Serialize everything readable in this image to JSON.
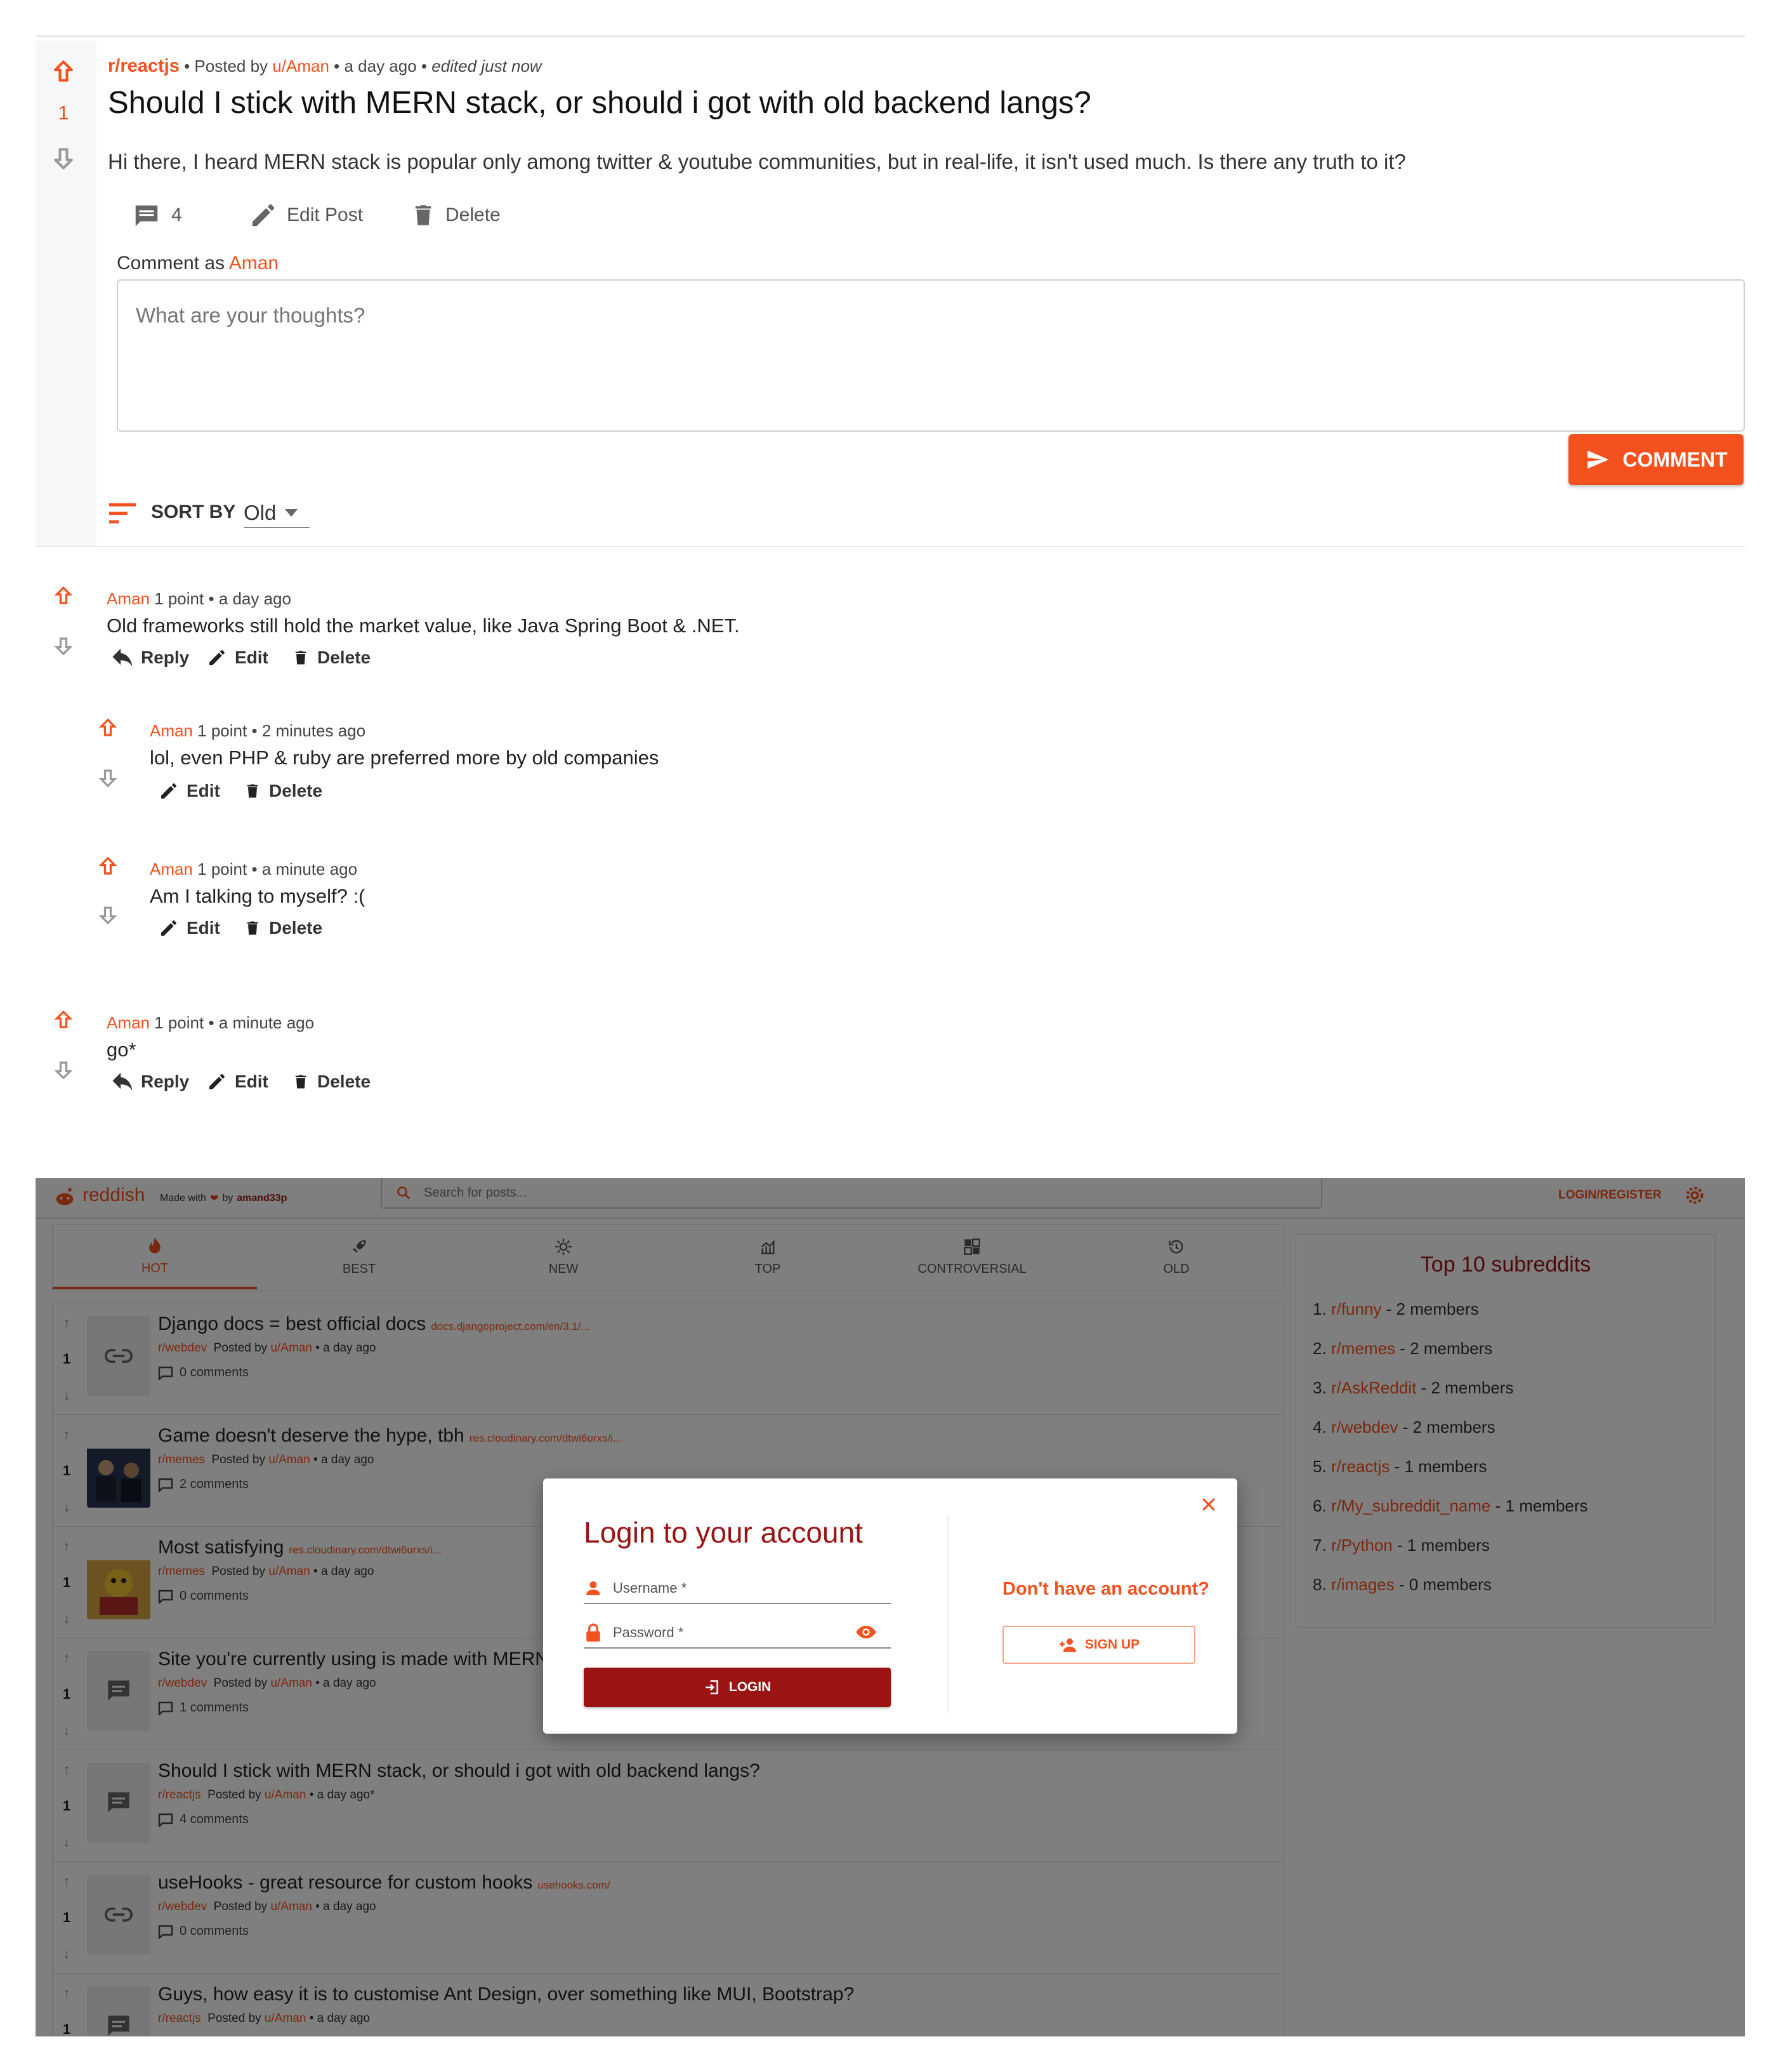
{
  "post": {
    "subreddit": "r/reactjs",
    "posted_by_prefix": "• Posted by",
    "author": "u/Aman",
    "time": "• a day ago •",
    "edited": "edited just now",
    "score": "1",
    "title": "Should I stick with MERN stack, or should i got with old backend langs?",
    "body": "Hi there, I heard MERN stack is popular only among twitter & youtube communities, but in real-life, it isn't used much. Is there any truth to it?",
    "comment_count": "4",
    "edit_label": "Edit Post",
    "delete_label": "Delete"
  },
  "comment_box": {
    "label_prefix": "Comment as",
    "user": "Aman",
    "placeholder": "What are your thoughts?",
    "submit_label": "COMMENT"
  },
  "sort": {
    "label": "SORT BY",
    "value": "Old"
  },
  "comments": [
    {
      "author": "Aman",
      "meta": "1 point • a day ago",
      "text": "Old frameworks still hold the market value, like Java Spring Boot & .NET.",
      "reply": "Reply",
      "edit": "Edit",
      "delete": "Delete"
    },
    {
      "author": "Aman",
      "meta": "1 point • 2 minutes ago",
      "text": "lol, even PHP & ruby are preferred more by old companies",
      "edit": "Edit",
      "delete": "Delete"
    },
    {
      "author": "Aman",
      "meta": "1 point • a minute ago",
      "text": "Am I talking to myself? :(",
      "edit": "Edit",
      "delete": "Delete"
    },
    {
      "author": "Aman",
      "meta": "1 point • a minute ago",
      "text": "go*",
      "reply": "Reply",
      "edit": "Edit",
      "delete": "Delete"
    }
  ],
  "app": {
    "brand": "reddish",
    "made_with": "Made with",
    "by": "by",
    "maker": "amand33p",
    "search_placeholder": "Search for posts...",
    "login_register": "LOGIN/REGISTER"
  },
  "tabs": [
    "HOT",
    "BEST",
    "NEW",
    "TOP",
    "CONTROVERSIAL",
    "OLD"
  ],
  "feed": [
    {
      "title": "Django docs = best official docs",
      "domain": "docs.djangoproject.com/en/3.1/...",
      "subreddit": "r/webdev",
      "posted_by": "Posted by",
      "author": "u/Aman",
      "time": "• a day ago",
      "comments": "0 comments",
      "score": "1",
      "thumb": "link-icon"
    },
    {
      "title": "Game doesn't deserve the hype, tbh",
      "domain": "res.cloudinary.com/dtwi6urxs/i...",
      "subreddit": "r/memes",
      "posted_by": "Posted by",
      "author": "u/Aman",
      "time": "• a day ago",
      "comments": "2 comments",
      "score": "1",
      "thumb": "image"
    },
    {
      "title": "Most satisfying",
      "domain": "res.cloudinary.com/dtwi6urxs/i...",
      "subreddit": "r/memes",
      "posted_by": "Posted by",
      "author": "u/Aman",
      "time": "• a day ago",
      "comments": "0 comments",
      "score": "1",
      "thumb": "image"
    },
    {
      "title": "Site you're currently using is made with MERN",
      "domain": "",
      "subreddit": "r/webdev",
      "posted_by": "Posted by",
      "author": "u/Aman",
      "time": "• a day ago",
      "comments": "1 comments",
      "score": "1",
      "thumb": "message-icon"
    },
    {
      "title": "Should I stick with MERN stack, or should i got with old backend langs?",
      "domain": "",
      "subreddit": "r/reactjs",
      "posted_by": "Posted by",
      "author": "u/Aman",
      "time": "• a day ago*",
      "comments": "4 comments",
      "score": "1",
      "thumb": "message-icon"
    },
    {
      "title": "useHooks - great resource for custom hooks",
      "domain": "usehooks.com/",
      "subreddit": "r/webdev",
      "posted_by": "Posted by",
      "author": "u/Aman",
      "time": "• a day ago",
      "comments": "0 comments",
      "score": "1",
      "thumb": "link-icon"
    },
    {
      "title": "Guys, how easy it is to customise Ant Design, over something like MUI, Bootstrap?",
      "domain": "",
      "subreddit": "r/reactjs",
      "posted_by": "Posted by",
      "author": "u/Aman",
      "time": "• a day ago",
      "comments": "",
      "score": "1",
      "thumb": "message-icon"
    }
  ],
  "sidebar": {
    "title": "Top 10 subreddits",
    "items": [
      {
        "num": "1.",
        "name": "r/funny",
        "members": "- 2 members"
      },
      {
        "num": "2.",
        "name": "r/memes",
        "members": "- 2 members"
      },
      {
        "num": "3.",
        "name": "r/AskReddit",
        "members": "- 2 members"
      },
      {
        "num": "4.",
        "name": "r/webdev",
        "members": "- 2 members"
      },
      {
        "num": "5.",
        "name": "r/reactjs",
        "members": "- 1 members"
      },
      {
        "num": "6.",
        "name": "r/My_subreddit_name",
        "members": "- 1 members"
      },
      {
        "num": "7.",
        "name": "r/Python",
        "members": "- 1 members"
      },
      {
        "num": "8.",
        "name": "r/images",
        "members": "- 0 members"
      }
    ]
  },
  "modal": {
    "title": "Login to your account",
    "username_label": "Username *",
    "password_label": "Password *",
    "login_label": "LOGIN",
    "no_account": "Don't have an account?",
    "signup_label": "SIGN UP"
  },
  "colors": {
    "accent": "#f4511e",
    "login_button": "#9b1414",
    "overlay": "rgba(0,0,0,0.5)"
  }
}
